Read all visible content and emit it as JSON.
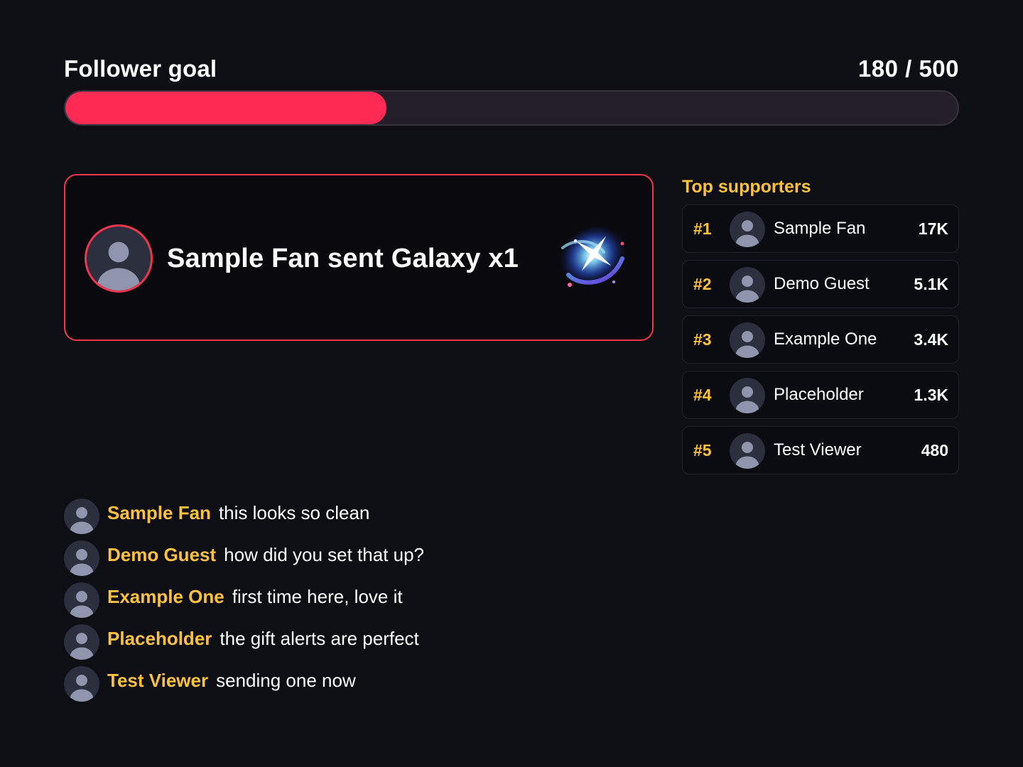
{
  "goal": {
    "title": "Follower goal",
    "count_text": "180 / 500",
    "current": 180,
    "target": 500,
    "fill_color": "#ff2b55"
  },
  "alert": {
    "text": "Sample Fan sent Galaxy x1",
    "avatar_icon": "user-avatar-icon",
    "gift_icon": "galaxy-gift-icon",
    "accent_color": "#f0354f"
  },
  "supporters": {
    "title": "Top supporters",
    "rows": [
      {
        "rank": "#1",
        "name": "Sample Fan",
        "amount": "17K"
      },
      {
        "rank": "#2",
        "name": "Demo Guest",
        "amount": "5.1K"
      },
      {
        "rank": "#3",
        "name": "Example One",
        "amount": "3.4K"
      },
      {
        "rank": "#4",
        "name": "Placeholder",
        "amount": "1.3K"
      },
      {
        "rank": "#5",
        "name": "Test Viewer",
        "amount": "480"
      }
    ]
  },
  "chat": {
    "messages": [
      {
        "user": "Sample Fan",
        "text": "this looks so clean"
      },
      {
        "user": "Demo Guest",
        "text": "how did you set that up?"
      },
      {
        "user": "Example One",
        "text": "first time here, love it"
      },
      {
        "user": "Placeholder",
        "text": "the gift alerts are perfect"
      },
      {
        "user": "Test Viewer",
        "text": "sending one now"
      }
    ]
  },
  "colors": {
    "background": "#0e0f14",
    "accent_gold": "#ffc23a",
    "avatar_bg": "#2b2f3e",
    "avatar_fg": "#8e95ad"
  }
}
